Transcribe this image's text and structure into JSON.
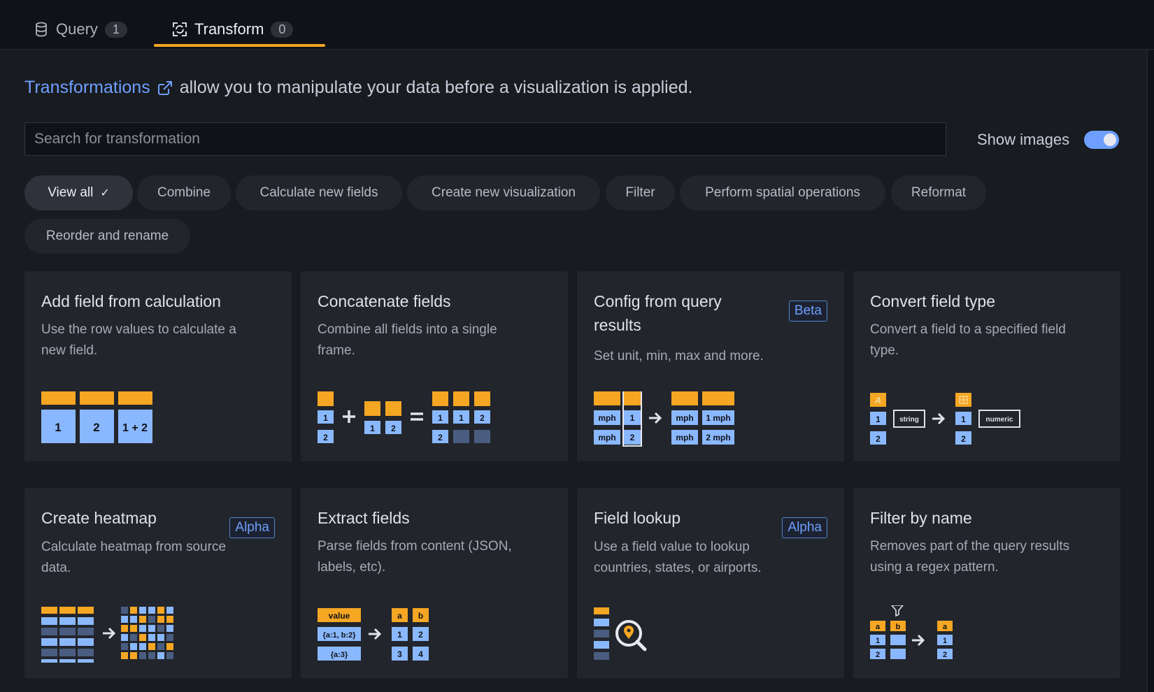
{
  "tabs": [
    {
      "label": "Query",
      "count": "1",
      "icon": "database-icon"
    },
    {
      "label": "Transform",
      "count": "0",
      "icon": "transform-icon"
    }
  ],
  "intro": {
    "link_text": "Transformations",
    "text": "allow you to manipulate your data before a visualization is applied."
  },
  "search": {
    "placeholder": "Search for transformation",
    "value": ""
  },
  "show_images": {
    "label": "Show images",
    "enabled": true
  },
  "filters": [
    {
      "label": "View all",
      "active": true
    },
    {
      "label": "Combine"
    },
    {
      "label": "Calculate new fields"
    },
    {
      "label": "Create new visualization"
    },
    {
      "label": "Filter"
    },
    {
      "label": "Perform spatial operations"
    },
    {
      "label": "Reformat"
    },
    {
      "label": "Reorder and rename"
    }
  ],
  "cards": [
    {
      "title": "Add field from calculation",
      "desc_lines": [
        "Use the row values to calculate a",
        "new field."
      ],
      "badge": ""
    },
    {
      "title": "Concatenate fields",
      "desc_lines": [
        "Combine all fields into a single",
        "frame."
      ],
      "badge": ""
    },
    {
      "title_lines": [
        "Config from query",
        "results"
      ],
      "desc_lines": [
        "Set unit, min, max and more."
      ],
      "badge": "Beta"
    },
    {
      "title": "Convert field type",
      "desc_lines": [
        "Convert a field to a specified field",
        "type."
      ],
      "badge": ""
    },
    {
      "title": "Create heatmap",
      "desc_lines": [
        "Calculate heatmap from source",
        "data."
      ],
      "badge": "Alpha"
    },
    {
      "title": "Extract fields",
      "desc_lines": [
        "Parse fields from content (JSON,",
        "labels, etc)."
      ],
      "badge": ""
    },
    {
      "title": "Field lookup",
      "desc_lines": [
        "Use a field value to lookup",
        "countries, states, or airports."
      ],
      "badge": "Alpha"
    },
    {
      "title": "Filter by name",
      "desc_lines": [
        "Removes part of the query results",
        "using a regex pattern."
      ],
      "badge": ""
    }
  ],
  "illustrations": {
    "add_field": [
      "1",
      "2",
      "1 + 2"
    ],
    "concatenate": [
      "1",
      "2",
      "1",
      "2",
      "1",
      "1",
      "2",
      "2"
    ],
    "config": [
      "mph",
      "mph",
      "1",
      "2",
      "mph",
      "mph",
      "1 mph",
      "2 mph"
    ],
    "convert": [
      "A",
      "1",
      "2",
      "string",
      "1",
      "2",
      "numeric"
    ],
    "extract": [
      "value",
      "{a:1, b:2}",
      "{a:3}",
      "a",
      "b",
      "1",
      "2",
      "3",
      "4"
    ],
    "filter_name": [
      "a",
      "b",
      "1",
      "2",
      "a",
      "1",
      "2"
    ]
  },
  "colors": {
    "accent": "#f5a623",
    "blue": "#8ab8ff",
    "link": "#6e9fff",
    "dark_cell": "#4a5d80"
  }
}
